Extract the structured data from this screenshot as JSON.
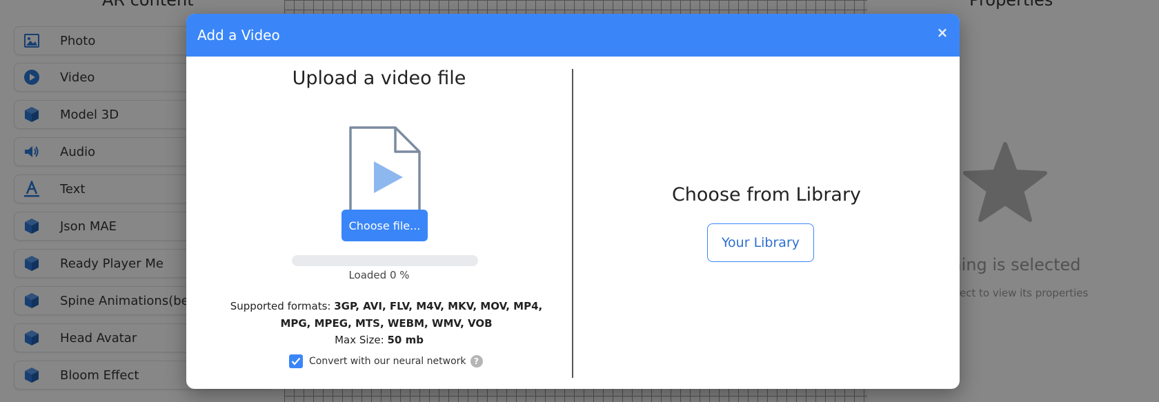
{
  "background": {
    "left_panel_title": "AR content",
    "content_items": [
      {
        "label": "Photo",
        "icon": "photo-icon"
      },
      {
        "label": "Video",
        "icon": "video-icon"
      },
      {
        "label": "Model 3D",
        "icon": "cube-icon"
      },
      {
        "label": "Audio",
        "icon": "speaker-icon"
      },
      {
        "label": "Text",
        "icon": "text-icon"
      },
      {
        "label": "Json MAE",
        "icon": "cube-icon"
      },
      {
        "label": "Ready Player Me",
        "icon": "cube-icon"
      },
      {
        "label": "Spine Animations(beta",
        "icon": "cube-icon"
      },
      {
        "label": "Head Avatar",
        "icon": "cube-icon"
      },
      {
        "label": "Bloom Effect",
        "icon": "cube-icon"
      }
    ],
    "right_panel_title": "Properties",
    "nothing_selected_title": "thing is selected",
    "nothing_selected_sub": "object to view its properties"
  },
  "modal": {
    "title": "Add a Video",
    "close_label": "×",
    "upload": {
      "title": "Upload a video file",
      "choose_button": "Choose file...",
      "progress_fraction": 0,
      "loaded_text": "Loaded 0 %",
      "supported_prefix": "Supported formats: ",
      "supported_formats": "3GP, AVI, FLV, M4V, MKV, MOV, MP4, MPG, MPEG, MTS, WEBM, WMV, VOB",
      "max_size_prefix": "Max Size: ",
      "max_size_value": "50 mb",
      "convert_label": "Convert with our neural network",
      "convert_checked": true,
      "help_label": "?"
    },
    "library": {
      "title": "Choose from Library",
      "button": "Your Library"
    }
  },
  "colors": {
    "accent": "#3a86f8",
    "annotation_underline": "#d42020"
  }
}
